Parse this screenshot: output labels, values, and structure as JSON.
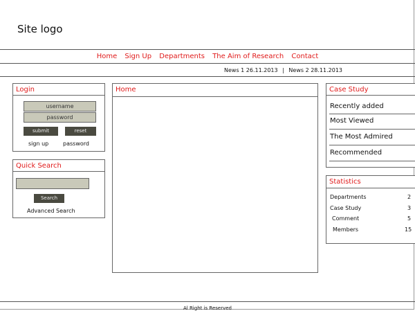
{
  "site": {
    "logo": "Site logo",
    "footer": "Al Right is Reserved"
  },
  "nav": {
    "items": [
      "Home",
      "Sign Up",
      "Departments",
      "The Aim of Research",
      "Contact"
    ]
  },
  "news": {
    "item1": "News 1 26.11.2013",
    "separator": "|",
    "item2": "News 2  28.11.2013"
  },
  "login": {
    "title": "Login",
    "username_placeholder": "username",
    "password_placeholder": "password",
    "submit": "submit",
    "reset": "reset",
    "sign_up": "sign up",
    "password_link": "password"
  },
  "quick_search": {
    "title": "Quick Search",
    "search_button": "Search",
    "advanced": "Advanced Search"
  },
  "main": {
    "title": "Home"
  },
  "case_study": {
    "title": "Case Study",
    "items": [
      "Recently added",
      "Most Viewed",
      "The Most Admired",
      "Recommended"
    ]
  },
  "statistics": {
    "title": "Statistics",
    "rows": [
      {
        "label": "Departments",
        "value": "2"
      },
      {
        "label": "Case Study",
        "value": "3"
      },
      {
        "label": "Comment",
        "value": "5"
      },
      {
        "label": "Members",
        "value": "15"
      }
    ]
  },
  "colors": {
    "accent": "#e01a1a",
    "field": "#c9c9b9",
    "button": "#4a4a40"
  }
}
